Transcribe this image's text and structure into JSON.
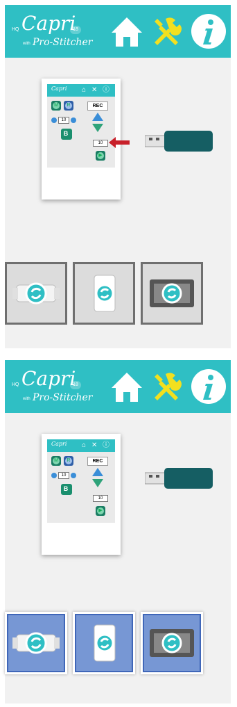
{
  "brand": {
    "hq": "HQ",
    "name": "Capri",
    "model": "18",
    "with": "with",
    "sub": "Pro-Stitcher"
  },
  "header_icons": [
    "home-icon",
    "tools-icon",
    "info-icon"
  ],
  "device": {
    "mini_brand": "Capri",
    "rec_label": "REC",
    "counter_value": "10",
    "length_value": "10",
    "b_label": "B"
  },
  "states": [
    {
      "usb_arrow": true,
      "tiles_active": false
    },
    {
      "usb_arrow": false,
      "tiles_active": true
    }
  ],
  "tiles": [
    "hoop-rotate-icon",
    "card-rotate-icon",
    "frame-rotate-icon"
  ],
  "colors": {
    "header": "#2fbfc4",
    "accent_yellow": "#f2e01f",
    "arrow_red": "#c8202a",
    "usb_body": "#155e63",
    "tile_active": "#7797d4"
  }
}
